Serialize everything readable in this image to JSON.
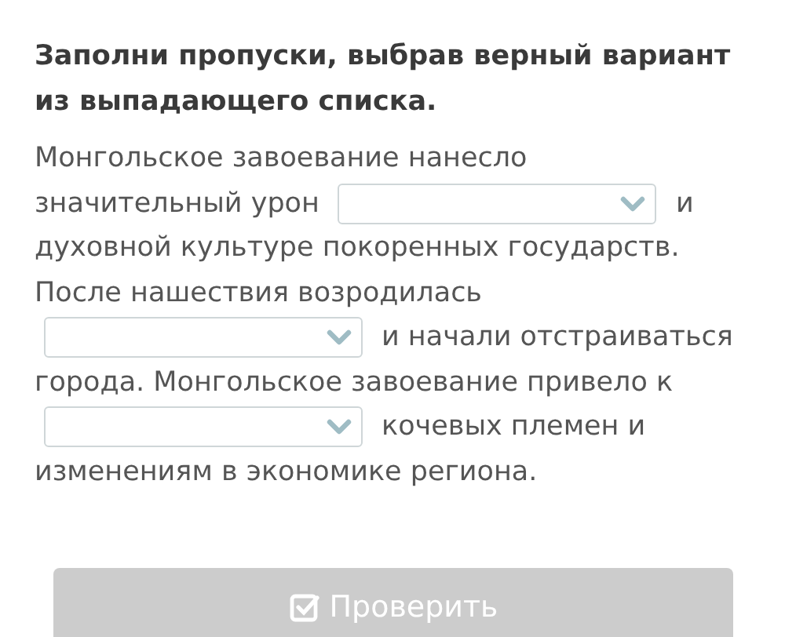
{
  "task": {
    "title": "Заполни пропуски, выбрав верный вариант из выпадающего списка.",
    "lines": [
      [
        {
          "kind": "text",
          "text": "Монгольское завоевание нанесло"
        }
      ],
      [
        {
          "kind": "text",
          "text": "значительный урон"
        },
        {
          "kind": "dropdown"
        },
        {
          "kind": "text",
          "text": "и"
        }
      ],
      [
        {
          "kind": "text",
          "text": "духовной культуре покоренных государств."
        }
      ],
      [
        {
          "kind": "text",
          "text": "После нашествия возродилась"
        }
      ],
      [
        {
          "kind": "dropdown"
        },
        {
          "kind": "text",
          "text": "и начали отстраиваться"
        }
      ],
      [
        {
          "kind": "text",
          "text": "города. Монгольское завоевание привело к"
        }
      ],
      [
        {
          "kind": "dropdown"
        },
        {
          "kind": "text",
          "text": "кочевых племен и"
        }
      ],
      [
        {
          "kind": "text",
          "text": "изменениям в экономике региона."
        }
      ]
    ]
  },
  "check_button": {
    "label": "Проверить",
    "disabled": true
  }
}
